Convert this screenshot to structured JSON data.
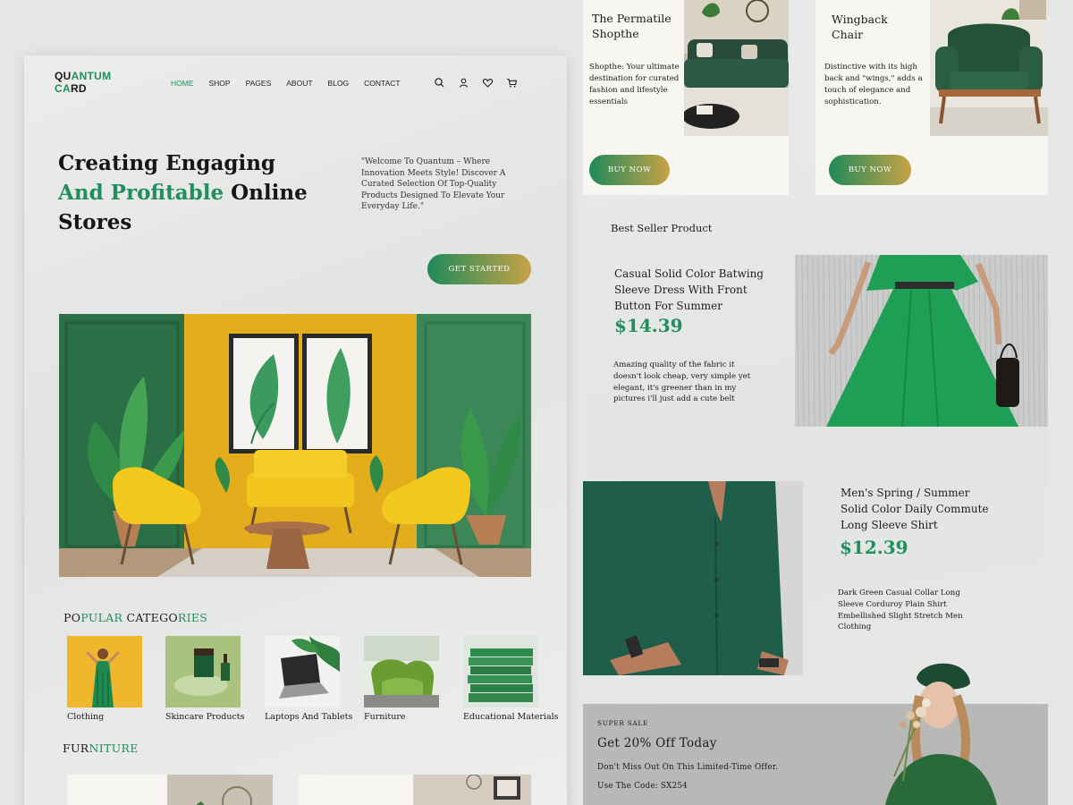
{
  "brand": {
    "line1_dark": "QU",
    "line1_green": "ANTUM",
    "line2_green": "CA",
    "line2_dark": "RD"
  },
  "nav": {
    "items": [
      "HOME",
      "SHOP",
      "PAGES",
      "ABOUT",
      "BLOG",
      "CONTACT"
    ],
    "active": "HOME",
    "icons": [
      "search-icon",
      "user-icon",
      "heart-icon",
      "cart-icon"
    ]
  },
  "hero": {
    "title_line1": "Creating Engaging",
    "title_green": "And Profitable",
    "title_rest": " Online",
    "title_line3": "Stores",
    "quote": "\"Welcome To Quantum  – Where Innovation Meets Style! Discover A Curated Selection Of Top-Quality Products Designed To Elevate Your Everyday Life.\"",
    "cta": "GET STARTED"
  },
  "categories": {
    "heading_parts": [
      {
        "text": "PO",
        "green": false
      },
      {
        "text": "PULAR",
        "green": true
      },
      {
        "text": " CATEGO",
        "green": false
      },
      {
        "text": "RIES",
        "green": true
      }
    ],
    "items": [
      "Clothing",
      "Skincare Products",
      "Laptops And Tablets",
      "Furniture",
      "Educational Materials"
    ],
    "active": "Furniture"
  },
  "furniture": {
    "heading_parts": [
      {
        "text": "FUR",
        "green": false
      },
      {
        "text": "NITURE",
        "green": true
      }
    ]
  },
  "products": [
    {
      "name": "The Permatile Shopthe",
      "desc": "Shopthe: Your ultimate destination for curated fashion and lifestyle essentials",
      "cta": "BUY NOW"
    },
    {
      "name": "Wingback Chair",
      "desc": "Distinctive with its high back and \"wings,\" adds a touch of elegance and sophistication.",
      "cta": "BUY NOW"
    }
  ],
  "best_seller": {
    "heading": "Best Seller Product",
    "items": [
      {
        "name": "Casual Solid Color Batwing Sleeve Dress With Front Button For Summer",
        "price": "$14.39",
        "review": "Amazing quality of the fabric it doesn't look cheap, very simple yet elegant, it's greener than in my pictures i'll just add a cute belt"
      },
      {
        "name": "Men's Spring / Summer Solid Color Daily Commute Long Sleeve Shirt",
        "price": "$12.39",
        "review": "Dark Green Casual Collar Long Sleeve Corduroy Plain Shirt Embellished Slight Stretch Men Clothing"
      }
    ]
  },
  "sale": {
    "eyebrow": "SUPER SALE",
    "headline": "Get 20% Off Today",
    "line1": "Don't Miss Out On This Limited-Time Offer.",
    "line2": "Use The Code: SX254"
  },
  "colors": {
    "accent_green": "#1f8f5c",
    "gradient_gold": "#c8a246",
    "sale_bg": "#b8b8b7"
  }
}
